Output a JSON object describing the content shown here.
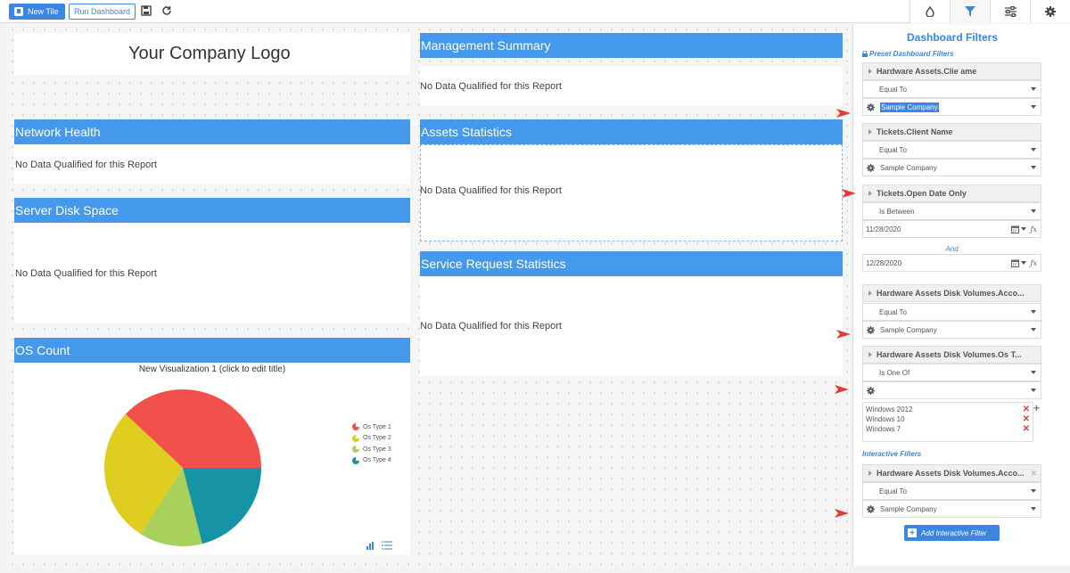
{
  "toolbar": {
    "new_tile": "New Tile",
    "run_dashboard": "Run Dashboard"
  },
  "tiles": {
    "logo": "Your Company Logo",
    "management_summary": {
      "title": "Management Summary",
      "message": "No Data Qualified for this Report"
    },
    "network_health": {
      "title": "Network Health",
      "message": "No Data Qualified for this Report"
    },
    "assets_statistics": {
      "title": "Assets Statistics",
      "message": "No Data Qualified for this Report"
    },
    "server_disk_space": {
      "title": "Server Disk Space",
      "message": "No Data Qualified for this Report"
    },
    "service_request_statistics": {
      "title": "Service Request Statistics",
      "message": "No Data Qualified for this Report"
    },
    "os_count": {
      "title": "OS Count",
      "viz_title": "New Visualization 1 (click to edit title)"
    }
  },
  "chart_data": {
    "type": "pie",
    "categories": [
      "Os Type 1",
      "Os Type 2",
      "Os Type 3",
      "Os Type 4"
    ],
    "values": [
      38,
      28,
      13,
      21
    ],
    "colors": [
      "#f2504b",
      "#dfcd1f",
      "#a8d15c",
      "#1693a5"
    ]
  },
  "panel": {
    "title": "Dashboard Filters",
    "preset_label": "Preset Dashboard Filters",
    "interactive_label": "Interactive Filters",
    "and_label": "And",
    "add_filter": "Add Interactive Filter",
    "filters": [
      {
        "field": "Hardware Assets.Clie     ame",
        "operator": "Equal To",
        "value": "Sample Company"
      },
      {
        "field": "Tickets.Client Name",
        "operator": "Equal To",
        "value": "Sample Company"
      },
      {
        "field": "Tickets.Open Date Only",
        "operator": "Is Between",
        "date_from": "11/28/2020",
        "date_to": "12/28/2020"
      },
      {
        "field": "Hardware Assets Disk Volumes.Acco...",
        "operator": "Equal To",
        "value": "Sample Company"
      },
      {
        "field": "Hardware Assets Disk Volumes.Os T...",
        "operator": "Is One Of",
        "value": "",
        "list": [
          "Windows 2012",
          "Windows 10",
          "Windows 7"
        ]
      },
      {
        "field": "Hardware Assets Disk Volumes.Acco...",
        "operator": "Equal To",
        "value": "Sample Company"
      }
    ]
  },
  "colors": {
    "accent": "#3a86e0",
    "header": "#4599ec",
    "arrow": "#e53935"
  }
}
